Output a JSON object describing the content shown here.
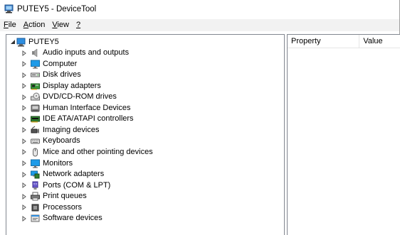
{
  "window": {
    "title": "PUTEY5 - DeviceTool"
  },
  "menu": [
    {
      "label": "File",
      "accel": "F",
      "rest": "ile"
    },
    {
      "label": "Action",
      "accel": "A",
      "rest": "ction"
    },
    {
      "label": "View",
      "accel": "V",
      "rest": "iew"
    },
    {
      "label": "?",
      "accel": "?",
      "rest": ""
    }
  ],
  "tree": {
    "root": {
      "label": "PUTEY5",
      "icon": "computer-icon",
      "expanded": true
    },
    "items": [
      {
        "label": "Audio inputs and outputs",
        "icon": "speaker-icon"
      },
      {
        "label": "Computer",
        "icon": "monitor-icon"
      },
      {
        "label": "Disk drives",
        "icon": "disk-drive-icon"
      },
      {
        "label": "Display adapters",
        "icon": "display-adapter-icon"
      },
      {
        "label": "DVD/CD-ROM drives",
        "icon": "dvd-drive-icon"
      },
      {
        "label": "Human Interface Devices",
        "icon": "hid-icon"
      },
      {
        "label": "IDE ATA/ATAPI controllers",
        "icon": "ide-controller-icon"
      },
      {
        "label": "Imaging devices",
        "icon": "camera-icon"
      },
      {
        "label": "Keyboards",
        "icon": "keyboard-icon"
      },
      {
        "label": "Mice and other pointing devices",
        "icon": "mouse-icon"
      },
      {
        "label": "Monitors",
        "icon": "monitor-icon"
      },
      {
        "label": "Network adapters",
        "icon": "network-adapter-icon"
      },
      {
        "label": "Ports (COM & LPT)",
        "icon": "port-icon"
      },
      {
        "label": "Print queues",
        "icon": "printer-icon"
      },
      {
        "label": "Processors",
        "icon": "processor-icon"
      },
      {
        "label": "Software devices",
        "icon": "software-device-icon"
      }
    ]
  },
  "properties": {
    "columns": [
      "Property",
      "Value"
    ]
  }
}
